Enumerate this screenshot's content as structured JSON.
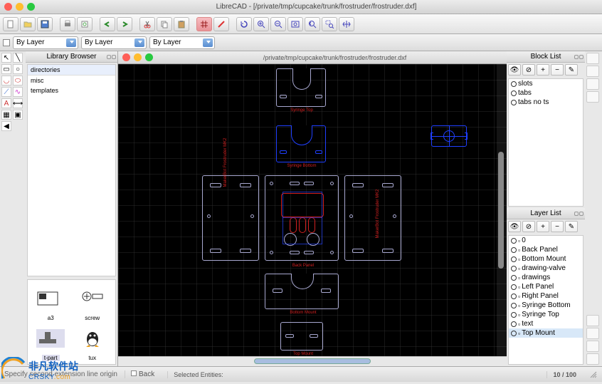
{
  "window": {
    "title": "LibreCAD - [/private/tmp/cupcake/trunk/frostruder/frostruder.dxf]"
  },
  "layer_combo": "By Layer",
  "library": {
    "panel_title": "Library Browser",
    "section": "directories",
    "items": [
      "misc",
      "templates"
    ],
    "previews": [
      {
        "name": "a3"
      },
      {
        "name": "screw"
      },
      {
        "name": "t-part"
      },
      {
        "name": "tux"
      }
    ]
  },
  "document": {
    "path": "/private/tmp/cupcake/trunk/frostruder/frostruder.dxf"
  },
  "blocks": {
    "panel_title": "Block List",
    "items": [
      "slots",
      "tabs",
      "tabs no ts"
    ]
  },
  "layers": {
    "panel_title": "Layer List",
    "items": [
      "0",
      "Back Panel",
      "Bottom Mount",
      "drawing-valve",
      "drawings",
      "Left Panel",
      "Right Panel",
      "Syringe Bottom",
      "Syringe Top",
      "text",
      "Top Mount"
    ]
  },
  "status": {
    "hint": "Specify second extension line origin",
    "seg1": "Back",
    "seg2": "Selected Entities:",
    "zoom": "10 / 100"
  },
  "watermark": {
    "line1": "非凡软件站",
    "line2": "CRSKY.com"
  }
}
